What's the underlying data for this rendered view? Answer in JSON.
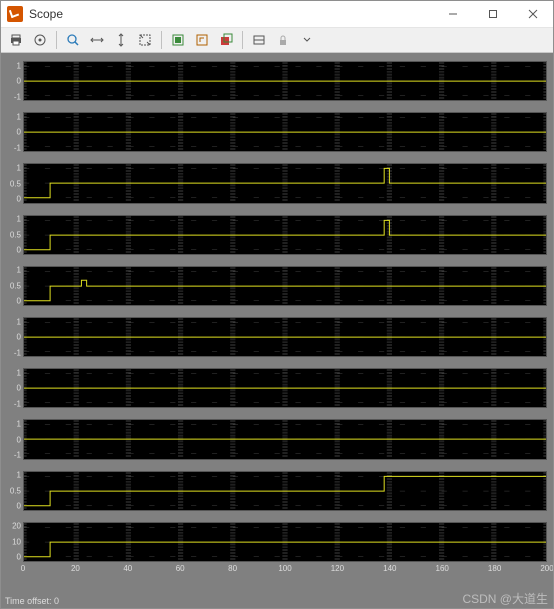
{
  "window": {
    "title": "Scope"
  },
  "toolbar": {
    "print": "Print",
    "params": "Parameters",
    "zoom": "Zoom",
    "zoomx": "Zoom X-axis",
    "zoomy": "Zoom Y-axis",
    "auto": "Autoscale",
    "saveax": "Save axes",
    "restax": "Restore axes",
    "float": "Floating scope",
    "sel": "Signal selector",
    "lock": "Lock axes",
    "more": "More"
  },
  "status": {
    "time_offset_label": "Time offset:",
    "time_offset_value": "0"
  },
  "watermark": "CSDN @大道生",
  "chart_data": {
    "type": "line",
    "xlim": [
      0,
      200
    ],
    "xticks": [
      0,
      20,
      40,
      60,
      80,
      100,
      120,
      140,
      160,
      180,
      200
    ],
    "subplots": [
      {
        "yticks": [
          -1,
          0,
          1
        ],
        "ylim": [
          -1.3,
          1.3
        ],
        "segments": [
          [
            0,
            0
          ],
          [
            200,
            0
          ]
        ]
      },
      {
        "yticks": [
          -1,
          0,
          1
        ],
        "ylim": [
          -1.3,
          1.3
        ],
        "segments": [
          [
            0,
            0
          ],
          [
            200,
            0
          ]
        ]
      },
      {
        "yticks": [
          0,
          0.5,
          1
        ],
        "ylim": [
          -0.15,
          1.15
        ],
        "segments": [
          [
            0,
            0
          ],
          [
            10,
            0
          ],
          [
            10,
            0.5
          ],
          [
            138,
            0.5
          ],
          [
            138,
            1
          ],
          [
            140,
            1
          ],
          [
            140,
            0.5
          ],
          [
            200,
            0.5
          ]
        ]
      },
      {
        "yticks": [
          0,
          0.5,
          1
        ],
        "ylim": [
          -0.15,
          1.15
        ],
        "segments": [
          [
            0,
            0
          ],
          [
            10,
            0
          ],
          [
            10,
            0.5
          ],
          [
            138,
            0.5
          ],
          [
            138,
            1
          ],
          [
            140,
            1
          ],
          [
            140,
            0.5
          ],
          [
            200,
            0.5
          ]
        ]
      },
      {
        "yticks": [
          0,
          0.5,
          1
        ],
        "ylim": [
          -0.15,
          1.15
        ],
        "segments": [
          [
            0,
            0
          ],
          [
            10,
            0
          ],
          [
            10,
            0.5
          ],
          [
            22,
            0.5
          ],
          [
            22,
            0.7
          ],
          [
            24,
            0.7
          ],
          [
            24,
            0.5
          ],
          [
            200,
            0.5
          ]
        ]
      },
      {
        "yticks": [
          -1,
          0,
          1
        ],
        "ylim": [
          -1.3,
          1.3
        ],
        "segments": [
          [
            0,
            0
          ],
          [
            200,
            0
          ]
        ]
      },
      {
        "yticks": [
          -1,
          0,
          1
        ],
        "ylim": [
          -1.3,
          1.3
        ],
        "segments": [
          [
            0,
            0
          ],
          [
            200,
            0
          ]
        ]
      },
      {
        "yticks": [
          -1,
          0,
          1
        ],
        "ylim": [
          -1.3,
          1.3
        ],
        "segments": [
          [
            0,
            0
          ],
          [
            200,
            0
          ]
        ]
      },
      {
        "yticks": [
          0,
          0.5,
          1
        ],
        "ylim": [
          -0.15,
          1.15
        ],
        "segments": [
          [
            0,
            0
          ],
          [
            10,
            0
          ],
          [
            10,
            0.5
          ],
          [
            138,
            0.5
          ],
          [
            138,
            1
          ],
          [
            200,
            1
          ]
        ]
      },
      {
        "yticks": [
          0,
          10,
          20
        ],
        "ylim": [
          -3,
          23
        ],
        "segments": [
          [
            0,
            0
          ],
          [
            10,
            0
          ],
          [
            10,
            10
          ],
          [
            200,
            10
          ]
        ]
      }
    ]
  }
}
